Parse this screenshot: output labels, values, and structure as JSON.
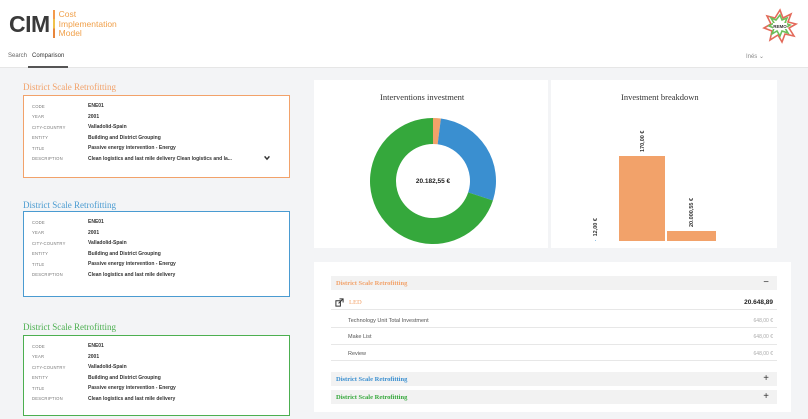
{
  "app": {
    "logo_short": "CIM",
    "logo_line1": "Cost",
    "logo_line2": "Implementation",
    "logo_line3": "Model"
  },
  "nav": {
    "search": "Search",
    "comparison": "Comparison",
    "language": "Inés"
  },
  "cards": [
    {
      "title": "District Scale Retrofitting",
      "color": "#f2a26a",
      "rows": [
        {
          "label": "CODE",
          "value": "ENE01"
        },
        {
          "label": "YEAR",
          "value": "2001"
        },
        {
          "label": "CITY-COUNTRY",
          "value": "Valladolid-Spain"
        },
        {
          "label": "ENTITY",
          "value": "Building and District Grouping"
        },
        {
          "label": "TITLE",
          "value": "Passive energy intervention - Energy"
        },
        {
          "label": "DESCRIPTION",
          "value": "Clean logistics and last mile delivery Clean logistics and la..."
        }
      ]
    },
    {
      "title": "District Scale Retrofitting",
      "color": "#4a9bd1",
      "rows": [
        {
          "label": "CODE",
          "value": "ENE01"
        },
        {
          "label": "YEAR",
          "value": "2001"
        },
        {
          "label": "CITY-COUNTRY",
          "value": "Valladolid-Spain"
        },
        {
          "label": "ENTITY",
          "value": "Building and District Grouping"
        },
        {
          "label": "TITLE",
          "value": "Passive energy intervention - Energy"
        },
        {
          "label": "DESCRIPTION",
          "value": "Clean logistics and last mile delivery"
        }
      ]
    },
    {
      "title": "District Scale Retrofitting",
      "color": "#4caf50",
      "rows": [
        {
          "label": "CODE",
          "value": "ENE01"
        },
        {
          "label": "YEAR",
          "value": "2001"
        },
        {
          "label": "CITY-COUNTRY",
          "value": "Valladolid-Spain"
        },
        {
          "label": "ENTITY",
          "value": "Building and District Grouping"
        },
        {
          "label": "TITLE",
          "value": "Passive energy intervention - Energy"
        },
        {
          "label": "DESCRIPTION",
          "value": "Clean logistics and last mile delivery"
        }
      ]
    }
  ],
  "investment_chart": {
    "title": "Interventions investment",
    "center_label": "20.182,55 €",
    "slices": [
      {
        "value": 2,
        "color": "#f2a26a"
      },
      {
        "value": 28,
        "color": "#3a8fd0"
      },
      {
        "value": 70,
        "color": "#35a83c"
      }
    ]
  },
  "chart_data": {
    "type": "bar",
    "title": "Investment breakdown",
    "categories": [
      "",
      "",
      ""
    ],
    "values": [
      12.0,
      170.0,
      20.0055
    ],
    "value_labels": [
      "12,00 €",
      "170,00 €",
      "20.000,55 €"
    ],
    "colors": [
      "#4a9bd1",
      "#f2a26a",
      "#f2a26a"
    ]
  },
  "breakdown": {
    "sections": [
      {
        "title": "District Scale Retrofitting",
        "color": "#f2a26a",
        "sign": "−"
      },
      {
        "title": "District Scale Retrofitting",
        "color": "#3a8fd0",
        "sign": "+"
      },
      {
        "title": "District Scale Retrofitting",
        "color": "#35a83c",
        "sign": "+"
      }
    ],
    "item_name": "LED",
    "item_total": "20.648,89",
    "sub_rows": [
      {
        "label": "Technology Unit Total Investment",
        "amount": "648,00 €"
      },
      {
        "label": "Make List",
        "amount": "648,00 €"
      },
      {
        "label": "Review",
        "amount": "648,00 €"
      }
    ]
  }
}
